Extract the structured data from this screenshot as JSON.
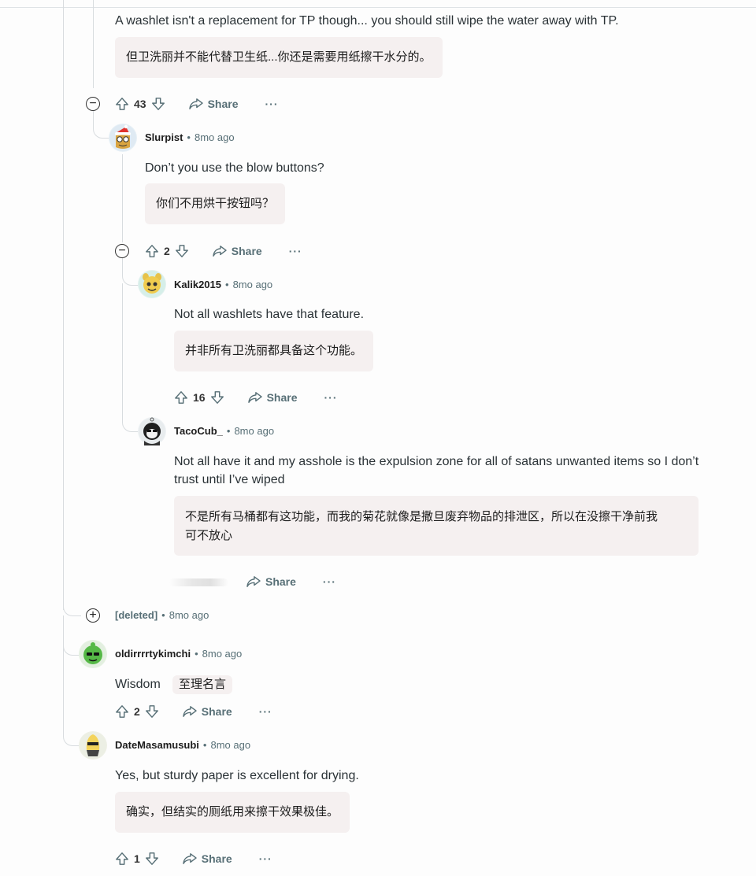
{
  "comments": [
    {
      "body": "A washlet isn't a replacement for TP though... you should still wipe the water away with TP.",
      "translation": "但卫洗丽并不能代替卫生纸...你还是需要用纸擦干水分的。",
      "votes": "43"
    },
    {
      "user": "Slurpist",
      "sep": "•",
      "time": "8mo ago",
      "body": "Don’t you use the blow buttons?",
      "translation": "你们不用烘干按钮吗？",
      "votes": "2"
    },
    {
      "user": "Kalik2015",
      "sep": "•",
      "time": "8mo ago",
      "body": "Not all washlets have that feature.",
      "translation": "并非所有卫洗丽都具备这个功能。",
      "votes": "16"
    },
    {
      "user": "TacoCub_",
      "sep": "•",
      "time": "8mo ago",
      "body_line1": "Not all have it and my asshole is the expulsion zone for all of satans unwanted items so I don’t",
      "body_line2": "trust until I’ve wiped",
      "translation_line1": "不是所有马桶都有这功能，而我的菊花就像是撒旦废弃物品的排泄区，所以在没擦干净前我",
      "translation_line2": "可不放心"
    },
    {
      "user": "[deleted]",
      "sep": "•",
      "time": "8mo ago"
    },
    {
      "user": "oldirrrrtykimchi",
      "sep": "•",
      "time": "8mo ago",
      "body": "Wisdom",
      "translation": "至理名言",
      "votes": "2"
    },
    {
      "user": "DateMasamusubi",
      "sep": "•",
      "time": "8mo ago",
      "body": "Yes, but sturdy paper is excellent for drying.",
      "translation": "确实，但结实的厕纸用来擦干效果极佳。",
      "votes": "1"
    }
  ],
  "labels": {
    "share": "Share",
    "more": "···",
    "collapse": "−",
    "expand": "+"
  },
  "colors": {
    "thread_line": "#d8dcdf",
    "translation_bg": "#f5f0f0",
    "action_gray": "#576f76"
  },
  "icons": [
    "upvote-icon",
    "downvote-icon",
    "share-icon",
    "more-icon",
    "collapse-icon",
    "expand-icon"
  ]
}
